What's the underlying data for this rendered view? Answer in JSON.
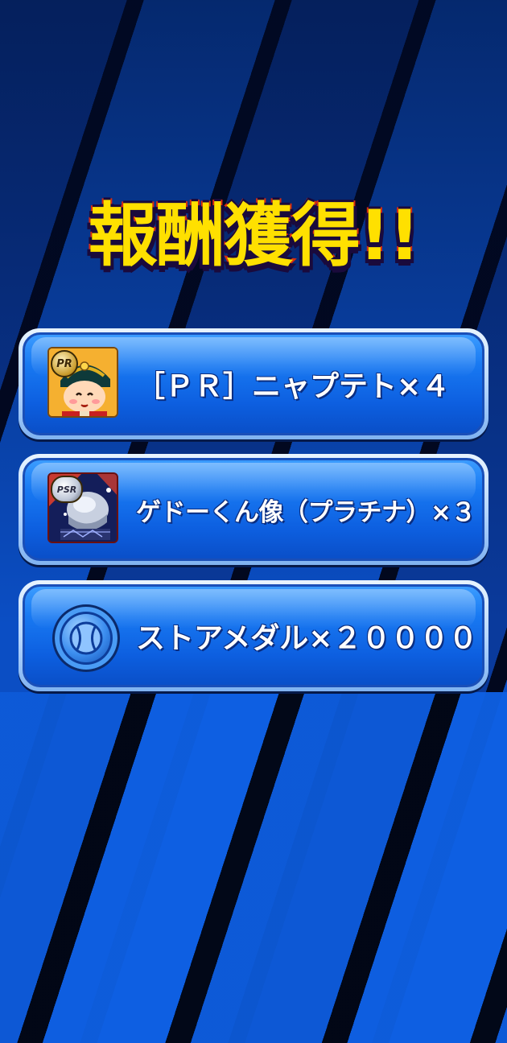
{
  "title": "報酬獲得!!",
  "rewards": [
    {
      "badge": "PR",
      "label": "［ＰＲ］ニャプテト×４",
      "icon": "character-card-icon"
    },
    {
      "badge": "PSR",
      "label": "ゲドーくん像（プラチナ）×３",
      "icon": "statue-card-icon"
    },
    {
      "label": "ストアメダル×２００００",
      "icon": "store-medal-icon"
    }
  ],
  "colors": {
    "title_fill": "#ffe000",
    "title_stroke": "#d82a10",
    "row_blue": "#1879f2",
    "row_border": "#e8f4ff"
  }
}
